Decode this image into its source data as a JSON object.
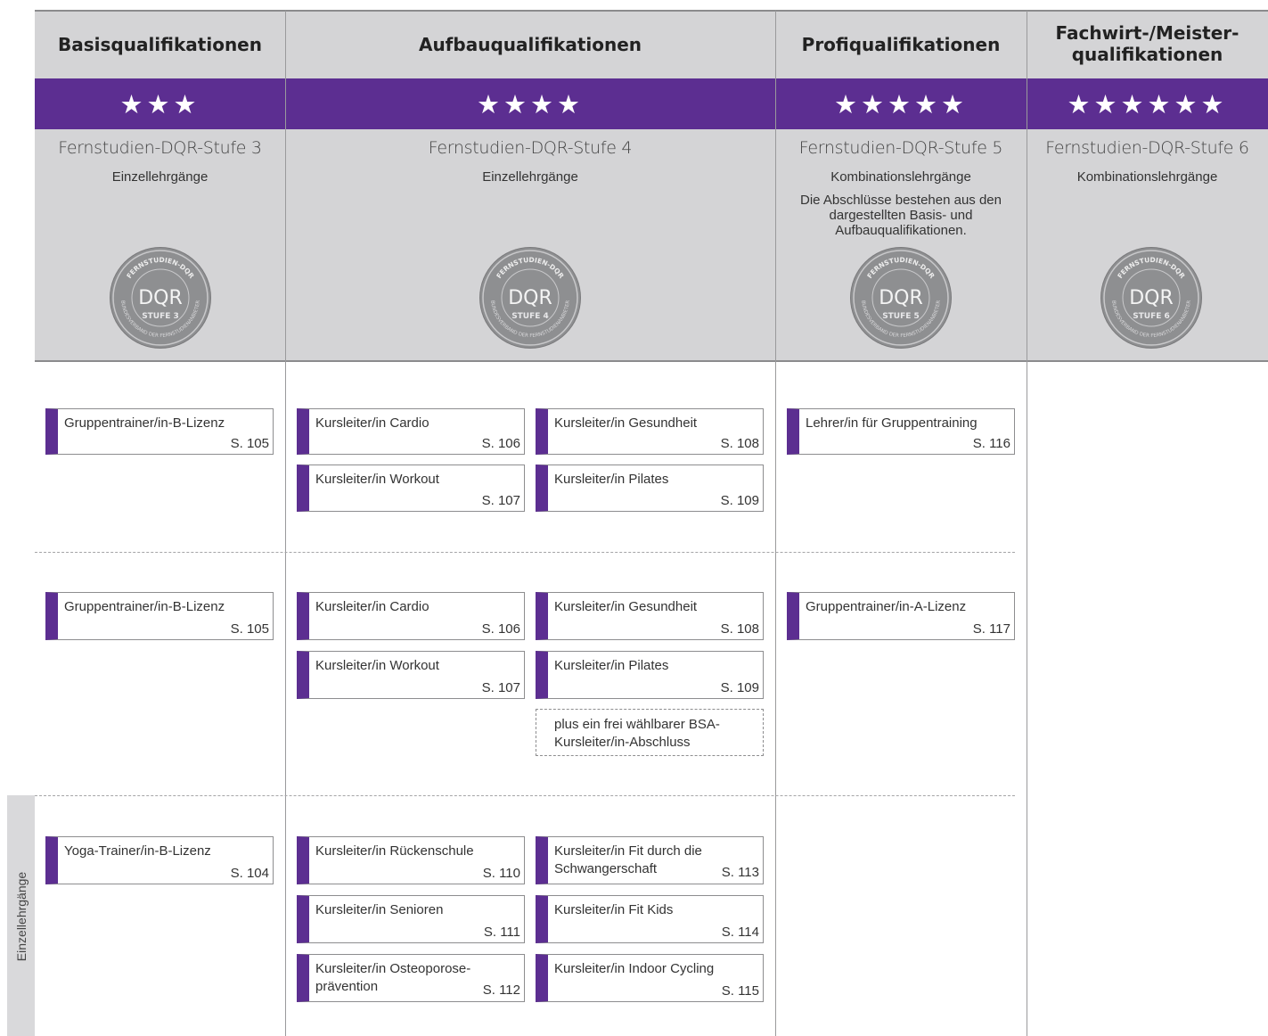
{
  "columns": [
    {
      "title": "Basisqualifikationen",
      "stars": "★★★",
      "level": "Fernstudien-DQR-Stufe 3",
      "type": "Einzellehrgänge",
      "note": "",
      "seal_level": "STUFE 3"
    },
    {
      "title": "Aufbauqualifikationen",
      "stars": "★★★★",
      "level": "Fernstudien-DQR-Stufe 4",
      "type": "Einzellehrgänge",
      "note": "",
      "seal_level": "STUFE 4"
    },
    {
      "title": "Profiqualifikationen",
      "stars": "★★★★★",
      "level": "Fernstudien-DQR-Stufe 5",
      "type": "Kombinationslehrgänge",
      "note": "Die Abschlüsse bestehen aus den dargestellten Basis- und Aufbauqualifikationen.",
      "seal_level": "STUFE 5"
    },
    {
      "title": "Fachwirt-/Meister-qualifikationen",
      "stars": "★★★★★★",
      "level": "Fernstudien-DQR-Stufe 6",
      "type": "Kombinationslehrgänge",
      "note": "",
      "seal_level": "STUFE 6"
    }
  ],
  "seal": {
    "ring_top": "FERNSTUDIEN-DQR",
    "ring_bottom": "BUNDESVERBAND DER FERNSTUDIENANBIETER",
    "center": "DQR"
  },
  "side_label": "Einzellehrgänge",
  "rows": [
    {
      "basis": [
        {
          "title": "Gruppentrainer/in-B-Lizenz",
          "page": "S. 105"
        }
      ],
      "aufbau": [
        {
          "title": "Kursleiter/in Cardio",
          "page": "S. 106"
        },
        {
          "title": "Kursleiter/in Gesundheit",
          "page": "S. 108"
        },
        {
          "title": "Kursleiter/in Workout",
          "page": "S. 107"
        },
        {
          "title": "Kursleiter/in Pilates",
          "page": "S. 109"
        }
      ],
      "profi": [
        {
          "title": "Lehrer/in für Gruppentraining",
          "page": "S. 116"
        }
      ]
    },
    {
      "basis": [
        {
          "title": "Gruppentrainer/in-B-Lizenz",
          "page": "S. 105"
        }
      ],
      "aufbau": [
        {
          "title": "Kursleiter/in Cardio",
          "page": "S. 106"
        },
        {
          "title": "Kursleiter/in Gesundheit",
          "page": "S. 108"
        },
        {
          "title": "Kursleiter/in Workout",
          "page": "S. 107"
        },
        {
          "title": "Kursleiter/in Pilates",
          "page": "S. 109"
        }
      ],
      "plus": "plus ein frei wählbarer BSA-Kursleiter/in-Abschluss",
      "profi": [
        {
          "title": "Gruppentrainer/in-A-Lizenz",
          "page": "S. 117"
        }
      ]
    },
    {
      "basis": [
        {
          "title": "Yoga-Trainer/in-B-Lizenz",
          "page": "S. 104"
        }
      ],
      "aufbau": [
        {
          "title": "Kursleiter/in Rückenschule",
          "page": "S. 110"
        },
        {
          "title": "Kursleiter/in Fit durch die Schwangerschaft",
          "page": "S. 113"
        },
        {
          "title": "Kursleiter/in Senioren",
          "page": "S. 111"
        },
        {
          "title": "Kursleiter/in Fit Kids",
          "page": "S. 114"
        },
        {
          "title": "Kursleiter/in Osteoporose-prävention",
          "page": "S. 112"
        },
        {
          "title": "Kursleiter/in Indoor Cycling",
          "page": "S. 115"
        }
      ]
    }
  ]
}
